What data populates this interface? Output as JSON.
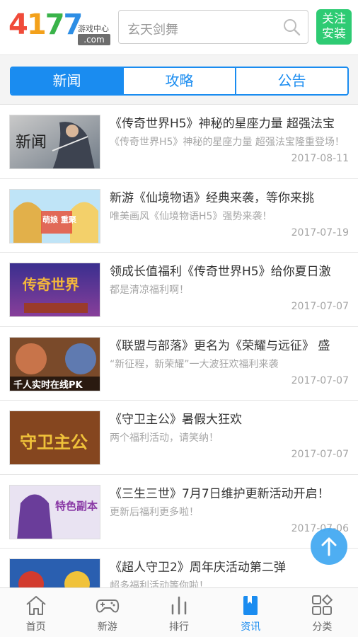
{
  "header": {
    "logo_num": [
      "4",
      "1",
      "7",
      "7"
    ],
    "logo_sub": "游戏中心",
    "logo_com": ".com",
    "search_placeholder": "玄天剑舞",
    "follow_label_1": "关注",
    "follow_label_2": "安装"
  },
  "tabs": [
    {
      "label": "新闻",
      "active": true
    },
    {
      "label": "攻略",
      "active": false
    },
    {
      "label": "公告",
      "active": false
    }
  ],
  "news": [
    {
      "title": "《传奇世界H5》神秘的星座力量 超强法宝",
      "desc": "《传奇世界H5》神秘的星座力量 超强法宝隆重登场！",
      "date": "2017-08-11",
      "thumb_text": "新闻"
    },
    {
      "title": "新游《仙境物语》经典来袭，等你来挑",
      "desc": "唯美画风《仙境物语H5》强势来袭！",
      "date": "2017-07-19",
      "thumb_text": "萌娘 重聚"
    },
    {
      "title": "领成长值福利《传奇世界H5》给你夏日激",
      "desc": "都是清凉福利啊！",
      "date": "2017-07-07",
      "thumb_text": "传奇世界"
    },
    {
      "title": "《联盟与部落》更名为《荣耀与远征》 盛",
      "desc": "“新征程，新荣耀”一大波狂欢福利来袭",
      "date": "2017-07-07",
      "thumb_text": "千人实时在线PK"
    },
    {
      "title": "《守卫主公》暑假大狂欢",
      "desc": "两个福利活动，请笑纳！",
      "date": "2017-07-07",
      "thumb_text": "守卫主公"
    },
    {
      "title": "《三生三世》7月7日维护更新活动开启！",
      "desc": "更新后福利更多啦！",
      "date": "2017-07-06",
      "thumb_text": "特色副本"
    },
    {
      "title": "《超人守卫2》周年庆活动第二弹",
      "desc": "超多福利活动等你啦！",
      "date": "",
      "thumb_text": ""
    }
  ],
  "bottom_nav": [
    {
      "label": "首页",
      "icon": "home-icon",
      "active": false
    },
    {
      "label": "新游",
      "icon": "gamepad-icon",
      "active": false
    },
    {
      "label": "排行",
      "icon": "ranking-icon",
      "active": false
    },
    {
      "label": "资讯",
      "icon": "bookmark-icon",
      "active": true
    },
    {
      "label": "分类",
      "icon": "category-icon",
      "active": false
    }
  ],
  "colors": {
    "accent": "#1a8cf0",
    "follow_green": "#2ecb73",
    "text_main": "#333333",
    "text_muted": "#a6a6a6"
  }
}
